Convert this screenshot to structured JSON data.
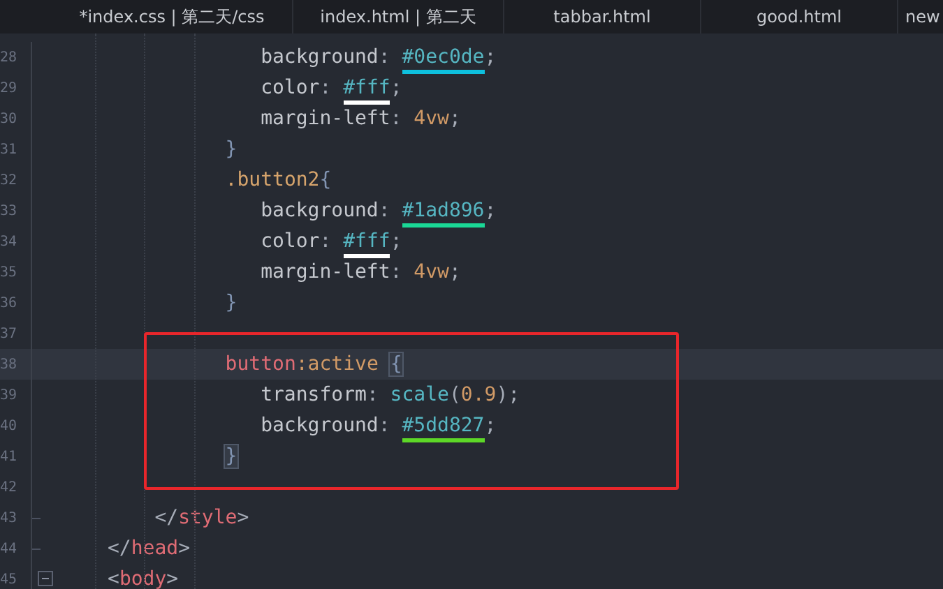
{
  "tabs": [
    {
      "label": "*index.css | 第二天/css",
      "selected": false
    },
    {
      "label": "index.html | 第二天",
      "selected": false
    },
    {
      "label": "tabbar.html",
      "selected": false
    },
    {
      "label": "good.html",
      "selected": false
    },
    {
      "label": "new",
      "selected": false
    }
  ],
  "editor": {
    "lines": [
      {
        "number": "28",
        "current": false,
        "tokens": [
          {
            "kind": "prop",
            "text": "background"
          },
          {
            "kind": "punct",
            "text": ": "
          },
          {
            "kind": "color",
            "text": "#0ec0de",
            "color": "#0ec0de"
          },
          {
            "kind": "punct",
            "text": ";"
          }
        ]
      },
      {
        "number": "29",
        "current": false,
        "tokens": [
          {
            "kind": "prop",
            "text": "color"
          },
          {
            "kind": "punct",
            "text": ": "
          },
          {
            "kind": "color",
            "text": "#fff",
            "color": "#ffffff"
          },
          {
            "kind": "punct",
            "text": ";"
          }
        ]
      },
      {
        "number": "30",
        "current": false,
        "tokens": [
          {
            "kind": "prop",
            "text": "margin-left"
          },
          {
            "kind": "punct",
            "text": ": "
          },
          {
            "kind": "number",
            "text": "4vw"
          },
          {
            "kind": "punct",
            "text": ";"
          }
        ]
      },
      {
        "number": "31",
        "current": false,
        "tokens": [
          {
            "kind": "brace",
            "text": "}"
          }
        ]
      },
      {
        "number": "32",
        "current": false,
        "tokens": [
          {
            "kind": "class",
            "text": ".button2"
          },
          {
            "kind": "brace",
            "text": "{"
          }
        ]
      },
      {
        "number": "33",
        "current": false,
        "tokens": [
          {
            "kind": "prop",
            "text": "background"
          },
          {
            "kind": "punct",
            "text": ": "
          },
          {
            "kind": "color",
            "text": "#1ad896",
            "color": "#1ad896"
          },
          {
            "kind": "punct",
            "text": ";"
          }
        ]
      },
      {
        "number": "34",
        "current": false,
        "tokens": [
          {
            "kind": "prop",
            "text": "color"
          },
          {
            "kind": "punct",
            "text": ": "
          },
          {
            "kind": "color",
            "text": "#fff",
            "color": "#ffffff"
          },
          {
            "kind": "punct",
            "text": ";"
          }
        ]
      },
      {
        "number": "35",
        "current": false,
        "tokens": [
          {
            "kind": "prop",
            "text": "margin-left"
          },
          {
            "kind": "punct",
            "text": ": "
          },
          {
            "kind": "number",
            "text": "4vw"
          },
          {
            "kind": "punct",
            "text": ";"
          }
        ]
      },
      {
        "number": "36",
        "current": false,
        "tokens": [
          {
            "kind": "brace",
            "text": "}"
          }
        ]
      },
      {
        "number": "37",
        "current": false
      },
      {
        "number": "38",
        "current": true,
        "tokens": [
          {
            "kind": "tag",
            "text": "button"
          },
          {
            "kind": "number",
            "text": ":active"
          },
          {
            "kind": "brace-match",
            "text": "{"
          }
        ]
      },
      {
        "number": "39",
        "current": false,
        "tokens": [
          {
            "kind": "prop",
            "text": "transform"
          },
          {
            "kind": "punct",
            "text": ": "
          },
          {
            "kind": "func",
            "text": "scale"
          },
          {
            "kind": "punct",
            "text": "("
          },
          {
            "kind": "number",
            "text": "0.9"
          },
          {
            "kind": "punct",
            "text": ");"
          }
        ]
      },
      {
        "number": "40",
        "current": false,
        "tokens": [
          {
            "kind": "prop",
            "text": "background"
          },
          {
            "kind": "punct",
            "text": ": "
          },
          {
            "kind": "color",
            "text": "#5dd827",
            "color": "#5dd827"
          },
          {
            "kind": "punct",
            "text": ";"
          }
        ]
      },
      {
        "number": "41",
        "current": false,
        "tokens": [
          {
            "kind": "brace-match",
            "text": "}"
          }
        ]
      },
      {
        "number": "42",
        "current": false
      },
      {
        "number": "43",
        "current": false,
        "tokens": [
          {
            "kind": "punct",
            "text": "</"
          },
          {
            "kind": "tag",
            "text": "style"
          },
          {
            "kind": "punct",
            "text": ">"
          }
        ]
      },
      {
        "number": "44",
        "current": false,
        "tokens": [
          {
            "kind": "punct",
            "text": "</"
          },
          {
            "kind": "tag",
            "text": "head"
          },
          {
            "kind": "punct",
            "text": ">"
          }
        ]
      },
      {
        "number": "45",
        "current": false,
        "collapsed": false,
        "tokens": [
          {
            "kind": "punct",
            "text": "<"
          },
          {
            "kind": "tag",
            "text": "body"
          },
          {
            "kind": "punct",
            "text": ">"
          }
        ]
      }
    ]
  }
}
